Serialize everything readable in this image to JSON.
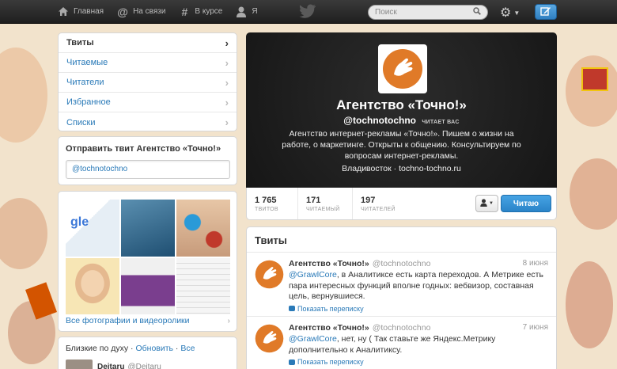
{
  "topbar": {
    "nav": [
      {
        "label": "Главная",
        "icon": "home-icon"
      },
      {
        "label": "На связи",
        "icon": "at-icon"
      },
      {
        "label": "В курсе",
        "icon": "hash-icon"
      },
      {
        "label": "Я",
        "icon": "person-icon"
      }
    ],
    "search_placeholder": "Поиск"
  },
  "sidebar": {
    "menu": [
      {
        "label": "Твиты",
        "active": true
      },
      {
        "label": "Читаемые"
      },
      {
        "label": "Читатели"
      },
      {
        "label": "Избранное"
      },
      {
        "label": "Списки"
      }
    ],
    "tweet_box": {
      "title": "Отправить твит Агентство «Точно!»",
      "value": "@tochnotochno"
    },
    "photos": {
      "all_link": "Все фотографии и видеоролики"
    },
    "similar": {
      "title": "Близкие по духу",
      "refresh": "Обновить",
      "all": "Все",
      "user_name": "Deitaru",
      "user_handle": "@Deitaru"
    }
  },
  "profile": {
    "name": "Агентство «Точно!»",
    "handle": "@tochnotochno",
    "follows_you": "ЧИТАЕТ ВАС",
    "bio": "Агентство интернет-рекламы «Точно!». Пишем о жизни на работе, о маркетинге. Открыты к общению.  Консультируем по вопросам интернет-рекламы.",
    "location": "Владивосток",
    "url": "tochno-tochno.ru",
    "stats": [
      {
        "count": "1 765",
        "label": "ТВИТОВ"
      },
      {
        "count": "171",
        "label": "ЧИТАЕМЫЙ"
      },
      {
        "count": "197",
        "label": "ЧИТАТЕЛЕЙ"
      }
    ],
    "follow_label": "Читаю"
  },
  "tweets": {
    "title": "Твиты",
    "items": [
      {
        "name": "Агентство «Точно!»",
        "handle": "@tochnotochno",
        "date": "8 июня",
        "mention": "@GrawlCore",
        "text": ", в Аналитиксе есть карта переходов. А Метрике есть пара интересных функций вполне годных: вебвизор, составная цель, вернувшиеся.",
        "conversation": "Показать переписку"
      },
      {
        "name": "Агентство «Точно!»",
        "handle": "@tochnotochno",
        "date": "7 июня",
        "mention": "@GrawlCore",
        "text": ", нет, ну ( Так ставьте же Яндекс.Метрику дополнительно к Аналитиксу.",
        "conversation": "Показать переписку"
      }
    ]
  },
  "colors": {
    "accent": "#2a7ab8",
    "brand_orange": "#e07a28",
    "follow_button": "#2a84c8"
  }
}
